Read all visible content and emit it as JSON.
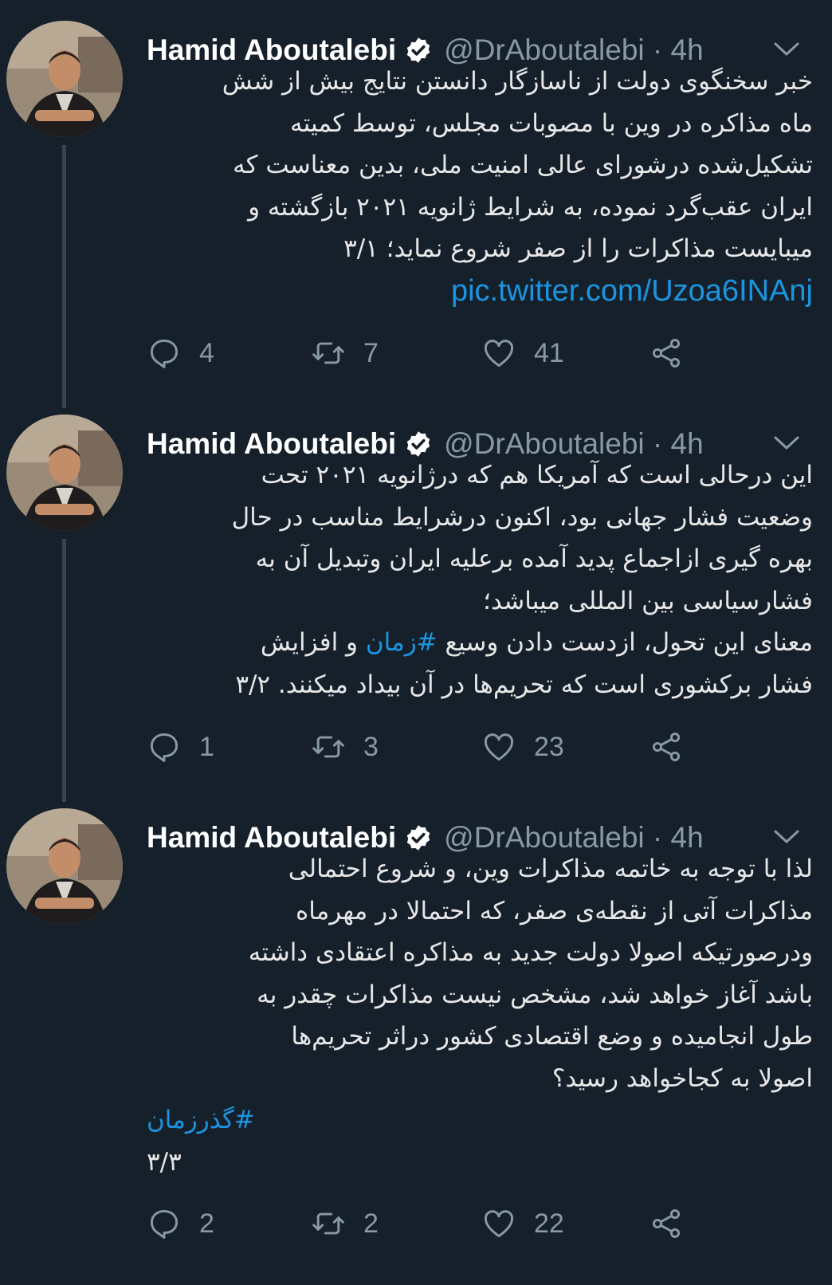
{
  "tweets": [
    {
      "author_name": "Hamid Aboutalebi",
      "handle_time": "@DrAboutalebi · 4h",
      "text_lines": [
        "خبر سخنگوی دولت از ناسازگار دانستن نتایج بیش از شش",
        "ماه مذاکره در وین با مصوبات مجلس، توسط کمیته",
        "تشکیل‌شده درشورای عالی امنیت ملی، بدین معناست که",
        "ایران عقب‌گرد نموده، به شرایط ژانویه ۲۰۲۱ بازگشته و",
        "میبایست مذاکرات را از صفر شروع نماید؛ ۳/۱"
      ],
      "link": "pic.twitter.com/Uzoa6INAnj",
      "replies": "4",
      "retweets": "7",
      "likes": "41"
    },
    {
      "author_name": "Hamid Aboutalebi",
      "handle_time": "@DrAboutalebi · 4h",
      "text_lines": [
        "این درحالی است که آمریکا هم که درژانویه ۲۰۲۱ تحت",
        "وضعیت فشار جهانی بود، اکنون درشرایط مناسب در حال",
        "بهره گیری ازاجماع پدید آمده برعلیه ایران وتبدیل آن به",
        "فشارسیاسی بین المللی میباشد؛"
      ],
      "line5_before": "معنای این تحول، ازدست دادن وسیع ",
      "line5_hashtag": "#زمان",
      "line5_after": " و افزایش",
      "line6": "فشار برکشوری است که تحریم‌ها در آن بیداد میکنند. ۳/۲",
      "replies": "1",
      "retweets": "3",
      "likes": "23"
    },
    {
      "author_name": "Hamid Aboutalebi",
      "handle_time": "@DrAboutalebi · 4h",
      "text_lines": [
        "لذا با توجه به خاتمه مذاکرات وین، و شروع احتمالی",
        "مذاکرات آتی از نقطه‌ی صفر، که احتمالا در مهرماه",
        "ودرصورتیکه اصولا دولت جدید به مذاکره اعتقادی داشته",
        "باشد آغاز خواهد شد، مشخص نیست مذاکرات چقدر به",
        "طول انجامیده و وضع اقتصادی کشور دراثر تحریم‌ها",
        "اصولا به کجاخواهد رسید؟"
      ],
      "hashtag": "#گذرزمان",
      "footer": "۳/۳",
      "replies": "2",
      "retweets": "2",
      "likes": "22"
    }
  ],
  "colors": {
    "background": "#15202b",
    "link": "#1b95e0",
    "secondary": "#8899a6",
    "thread_line": "#38444d"
  },
  "icons": [
    "verified-badge-icon",
    "chevron-down-icon",
    "reply-icon",
    "retweet-icon",
    "like-icon",
    "share-icon"
  ]
}
